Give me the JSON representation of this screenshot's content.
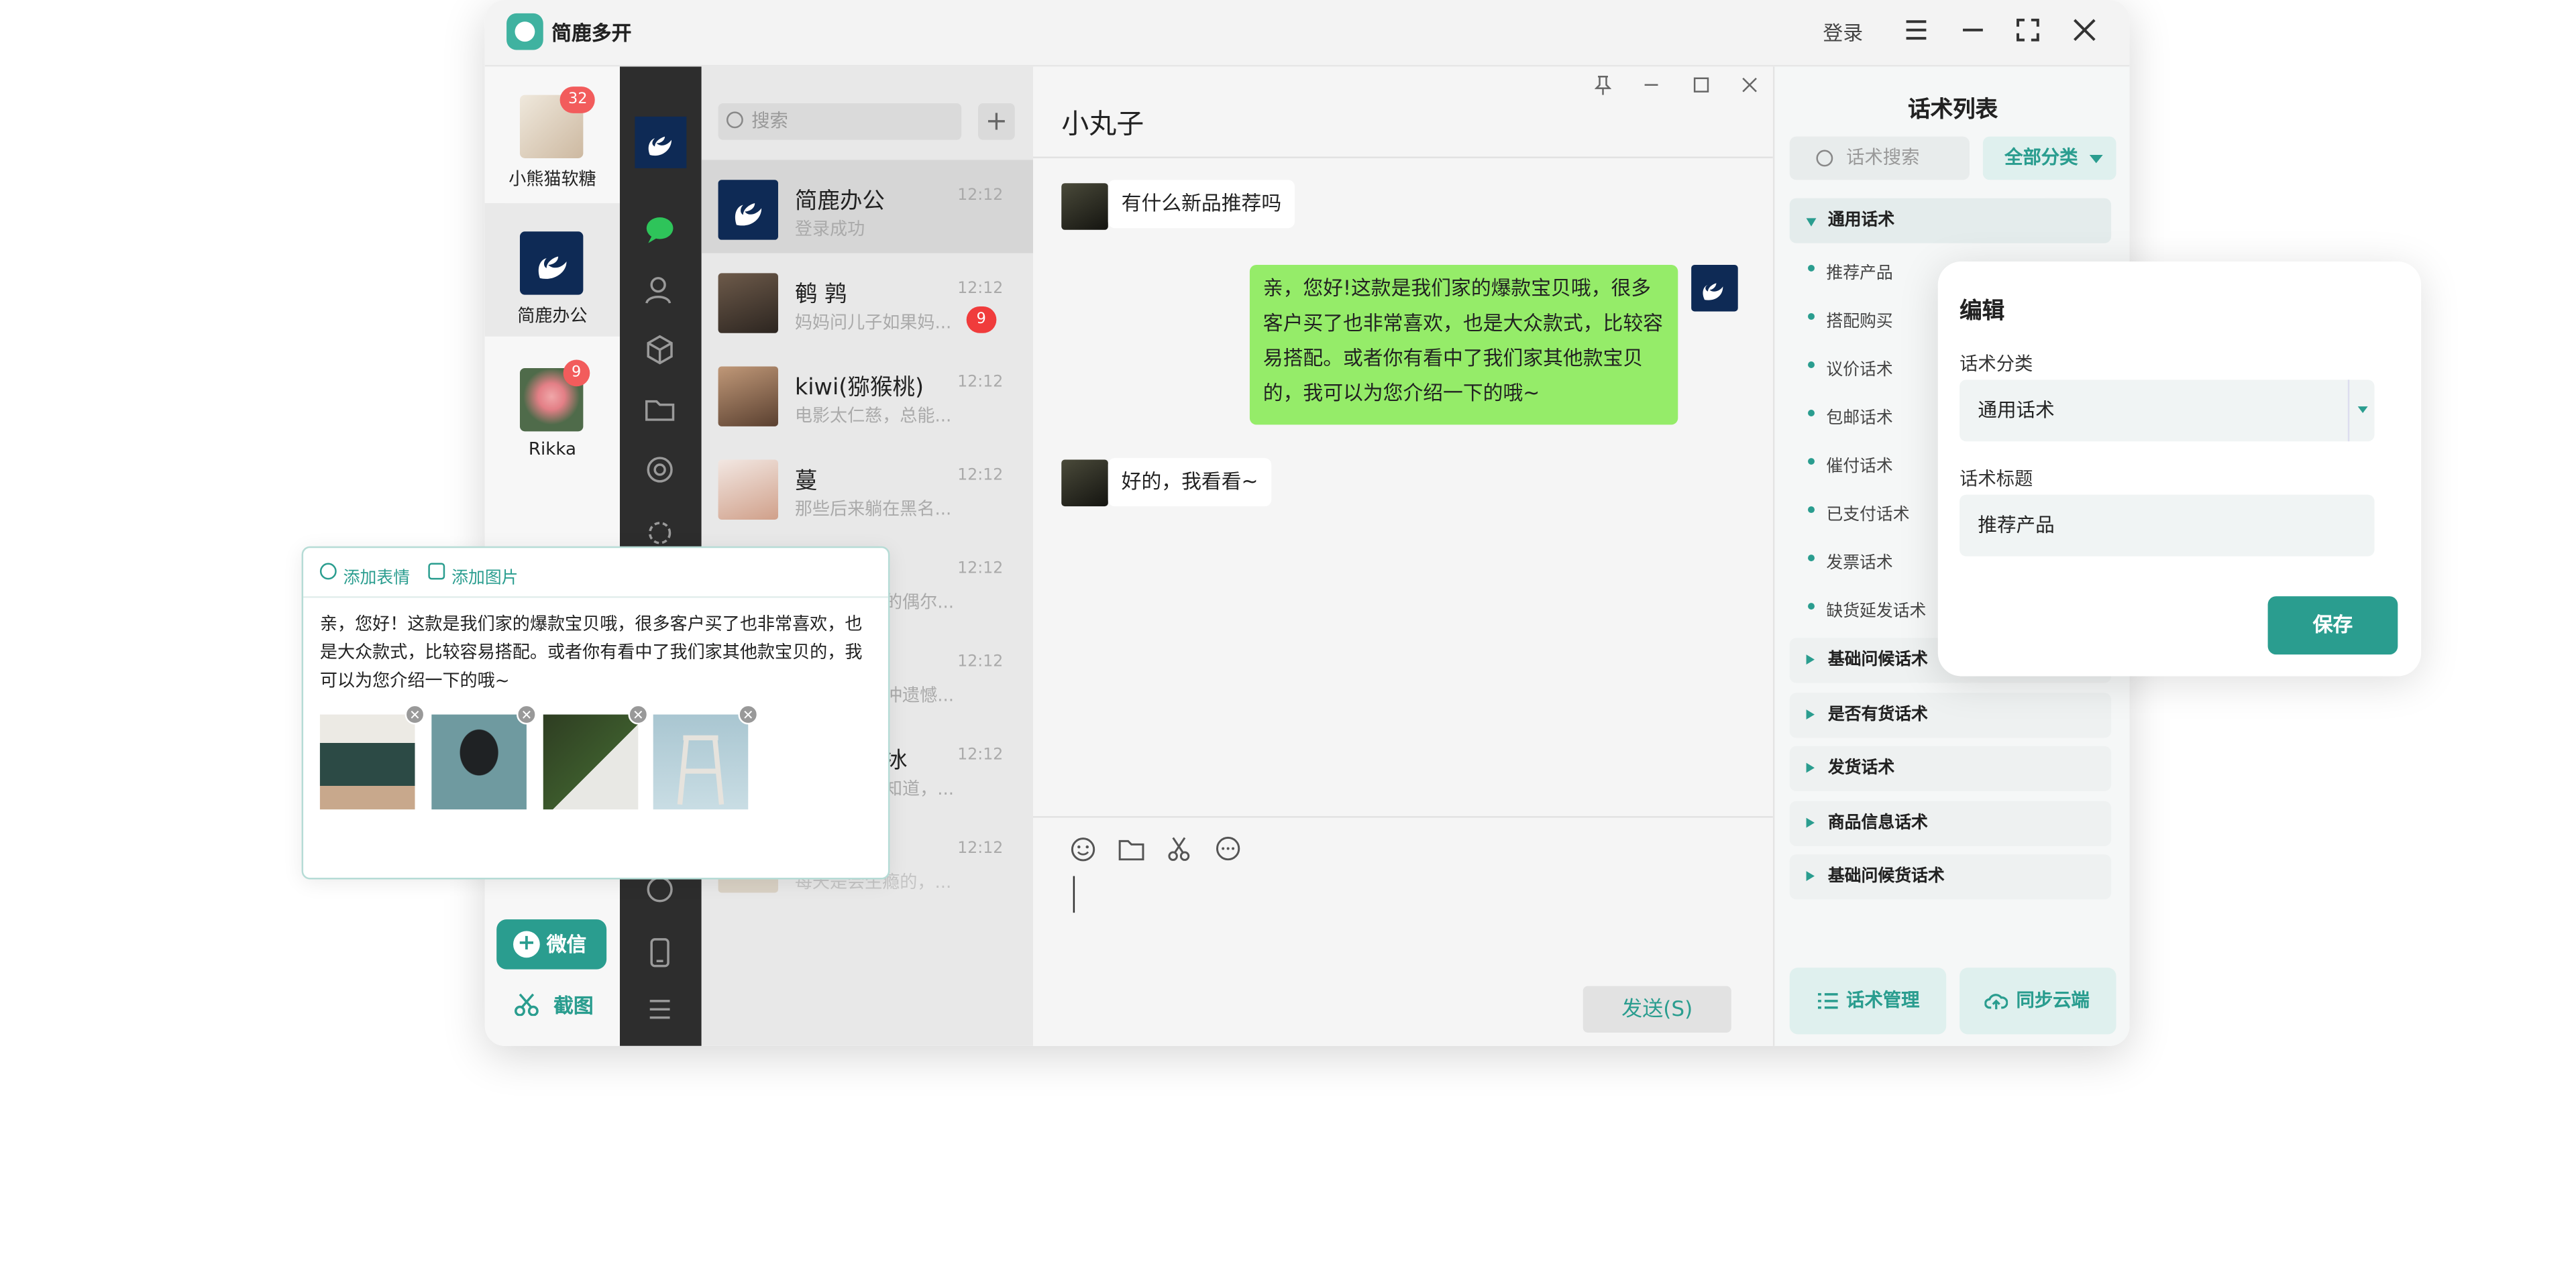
{
  "app": {
    "title": "简鹿多开",
    "login": "登录"
  },
  "accounts": [
    {
      "name": "小熊猫软糖",
      "badge": "32"
    },
    {
      "name": "简鹿办公",
      "badge": ""
    },
    {
      "name": "Rikka",
      "badge": "9"
    }
  ],
  "bottom_actions": {
    "wechat": "微信",
    "screenshot": "截图"
  },
  "conversations": {
    "search_placeholder": "搜索",
    "items": [
      {
        "name": "简鹿办公",
        "preview": "登录成功",
        "time": "12:12",
        "badge": ""
      },
      {
        "name": "鹌 鹑",
        "preview": "妈妈问儿子如果妈...",
        "time": "12:12",
        "badge": "9"
      },
      {
        "name": "kiwi(猕猴桃)",
        "preview": "电影太仁慈，总能...",
        "time": "12:12",
        "badge": ""
      },
      {
        "name": "蔓",
        "preview": "那些后来躺在黑名...",
        "time": "12:12",
        "badge": ""
      },
      {
        "name": "",
        "preview": "的偶尔...",
        "time": "12:12",
        "badge": ""
      },
      {
        "name": "",
        "preview": "冲遗憾...",
        "time": "12:12",
        "badge": ""
      },
      {
        "name": "冰",
        "preview": "知道，...",
        "time": "12:12",
        "badge": ""
      },
      {
        "name": "",
        "preview": "每天是会生瘾的，...",
        "time": "12:12",
        "badge": ""
      }
    ]
  },
  "chat": {
    "title": "小丸子",
    "messages": [
      {
        "from": "other",
        "text": "有什么新品推荐吗"
      },
      {
        "from": "me",
        "text": "亲，您好!这款是我们家的爆款宝贝哦，很多客户买了也非常喜欢，也是大众款式，比较容易搭配。或者你有看中了我们家其他款宝贝的，我可以为您介绍一下的哦~"
      },
      {
        "from": "other",
        "text": "好的，我看看~"
      }
    ],
    "send_label": "发送(S)"
  },
  "scripts_panel": {
    "title": "话术列表",
    "search_placeholder": "话术搜索",
    "category_filter": "全部分类",
    "open_group": "通用话术",
    "subitems": [
      "推荐产品",
      "搭配购买",
      "议价话术",
      "包邮话术",
      "催付话术",
      "已支付话术",
      "发票话术",
      "缺货延发话术"
    ],
    "groups": [
      "基础问候话术",
      "是否有货话术",
      "发货话术",
      "商品信息话术",
      "基础问候货话术"
    ],
    "manage_label": "话术管理",
    "sync_label": "同步云端"
  },
  "edit_dialog": {
    "title": "编辑",
    "category_label": "话术分类",
    "category_value": "通用话术",
    "title_label": "话术标题",
    "title_value": "推荐产品",
    "save_label": "保存"
  },
  "quick_reply_popup": {
    "add_emoji": "添加表情",
    "add_image": "添加图片",
    "text": "亲，您好！这款是我们家的爆款宝贝哦，很多客户买了也非常喜欢，也是大众款式，比较容易搭配。或者你有看中了我们家其他款宝贝的，我可以为您介绍一下的哦~",
    "images": [
      "sofa-image",
      "chair-image",
      "box-image",
      "stool-image"
    ]
  },
  "colors": {
    "accent": "#2a9d8f",
    "badge": "#f25c5c",
    "my_bubble": "#95ec69",
    "iconbar": "#2d2d2d"
  }
}
